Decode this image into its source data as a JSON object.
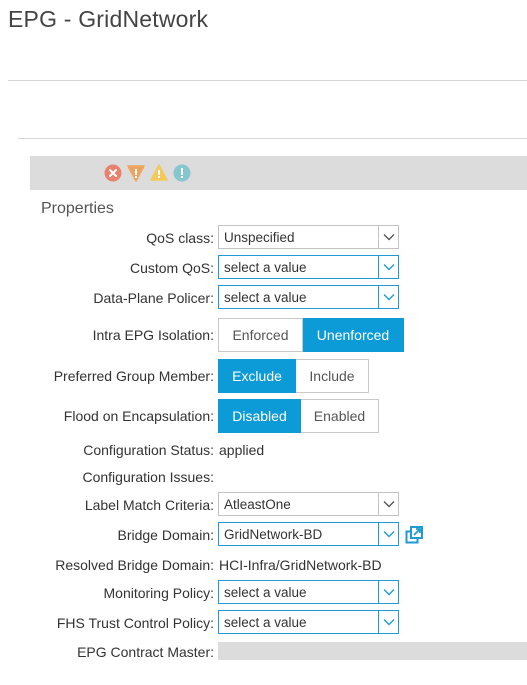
{
  "page": {
    "title": "EPG - GridNetwork",
    "section_title": "Properties"
  },
  "faults": [
    {
      "icon": "critical-fault-icon",
      "color": "#e8826f"
    },
    {
      "icon": "major-fault-icon",
      "color": "#f0a35e"
    },
    {
      "icon": "minor-fault-icon",
      "color": "#f3c95b"
    },
    {
      "icon": "warning-fault-icon",
      "color": "#86c6cf"
    }
  ],
  "fields": {
    "qos_class": {
      "label": "QoS class:",
      "value": "Unspecified"
    },
    "custom_qos": {
      "label": "Custom QoS:",
      "placeholder": "select a value"
    },
    "data_plane_policer": {
      "label": "Data-Plane Policer:",
      "placeholder": "select a value"
    },
    "intra_epg_isolation": {
      "label": "Intra EPG Isolation:",
      "options": [
        "Enforced",
        "Unenforced"
      ],
      "selected": "Unenforced"
    },
    "preferred_group_member": {
      "label": "Preferred Group Member:",
      "options": [
        "Exclude",
        "Include"
      ],
      "selected": "Exclude"
    },
    "flood_on_encapsulation": {
      "label": "Flood on Encapsulation:",
      "options": [
        "Disabled",
        "Enabled"
      ],
      "selected": "Disabled"
    },
    "configuration_status": {
      "label": "Configuration Status:",
      "value": "applied"
    },
    "configuration_issues": {
      "label": "Configuration Issues:",
      "value": ""
    },
    "label_match_criteria": {
      "label": "Label Match Criteria:",
      "value": "AtleastOne"
    },
    "bridge_domain": {
      "label": "Bridge Domain:",
      "value": "GridNetwork-BD"
    },
    "resolved_bridge_domain": {
      "label": "Resolved Bridge Domain:",
      "value": "HCI-Infra/GridNetwork-BD"
    },
    "monitoring_policy": {
      "label": "Monitoring Policy:",
      "placeholder": "select a value"
    },
    "fhs_trust_control_policy": {
      "label": "FHS Trust Control Policy:",
      "placeholder": "select a value"
    },
    "epg_contract_master": {
      "label": "EPG Contract Master:"
    }
  },
  "colors": {
    "accent": "#0d9bd8",
    "focus_border": "#1f9ad6"
  }
}
